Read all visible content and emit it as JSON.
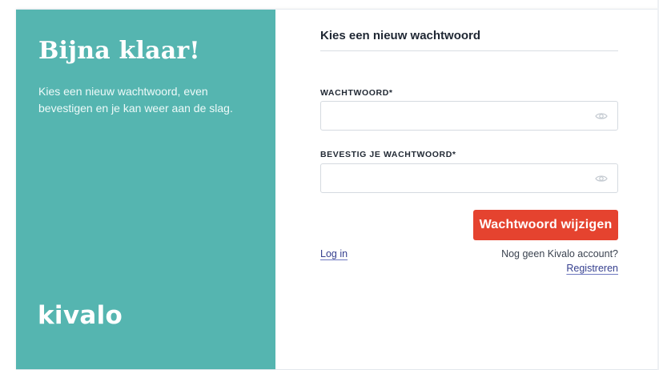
{
  "left_panel": {
    "heading": "Bijna klaar!",
    "intro": "Kies een nieuw wachtwoord, even bevestigen en je kan weer aan de slag.",
    "logo_text": "kivalo",
    "background_color": "#55b5b0"
  },
  "form": {
    "title": "Kies een nieuw wachtwoord",
    "password_label": "WACHTWOORD*",
    "password_value": "",
    "confirm_label": "BEVESTIG JE WACHTWOORD*",
    "confirm_value": "",
    "toggle_icon": "eye-icon",
    "submit_label": "Wachtwoord wijzigen",
    "submit_color": "#e5432f"
  },
  "footer": {
    "login_link": "Log in",
    "no_account_text": "Nog geen Kivalo account?",
    "register_link": "Registreren",
    "link_color": "#36408f"
  }
}
